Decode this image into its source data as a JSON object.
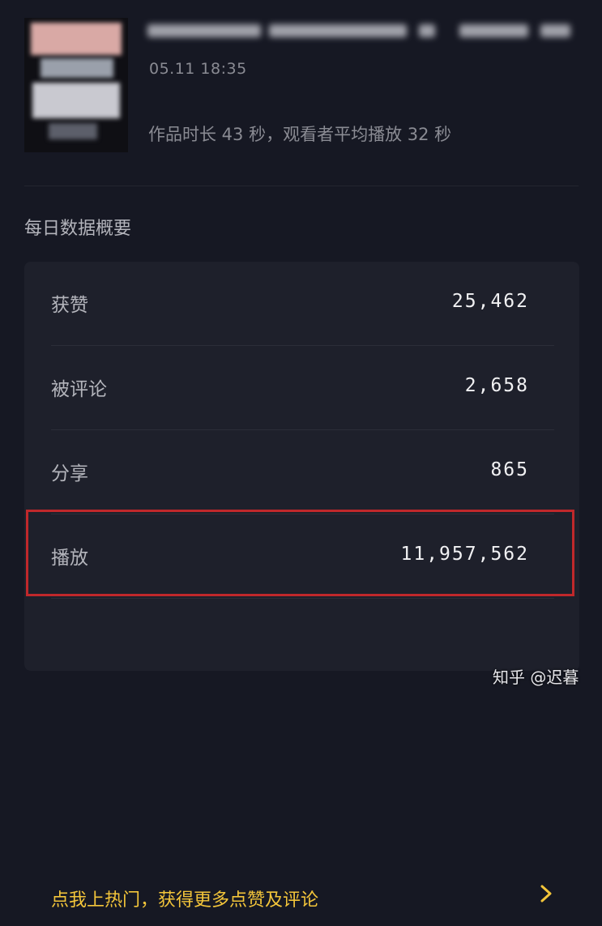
{
  "post": {
    "time": "05.11 18:35",
    "duration_text": "作品时长 43 秒，观看者平均播放 32 秒"
  },
  "section": {
    "title": "每日数据概要"
  },
  "stats": [
    {
      "label": "获赞",
      "value": "25,462"
    },
    {
      "label": "被评论",
      "value": "2,658"
    },
    {
      "label": "分享",
      "value": "865"
    },
    {
      "label": "播放",
      "value": "11,957,562"
    }
  ],
  "promo": {
    "text": "点我上热门，获得更多点赞及评论"
  },
  "watermark": "知乎 @迟暮",
  "colors": {
    "background": "#161823",
    "card": "#1e202b",
    "accent_yellow": "#f3c53a",
    "highlight_red": "#c0282b"
  },
  "icons": {
    "promo_arrow": "chevron-right-icon"
  }
}
